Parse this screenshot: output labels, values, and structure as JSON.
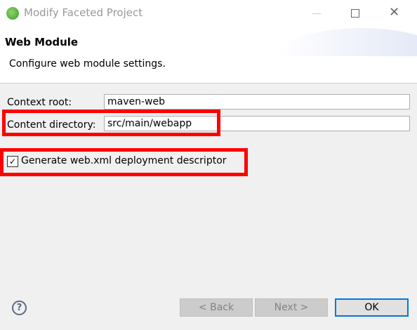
{
  "window": {
    "title": "Modify Faceted Project"
  },
  "header": {
    "title": "Web Module",
    "description": "Configure web module settings."
  },
  "form": {
    "context_root": {
      "label": "Context root:",
      "value": "maven-web"
    },
    "content_directory": {
      "label": "Content directory:",
      "value": "src/main/webapp"
    },
    "generate_descriptor": {
      "label": "Generate web.xml deployment descriptor",
      "checked": true
    }
  },
  "buttons": {
    "back": "< Back",
    "next": "Next >",
    "ok": "OK"
  },
  "highlight_color": "#ff0000",
  "accent": "#0078d7"
}
